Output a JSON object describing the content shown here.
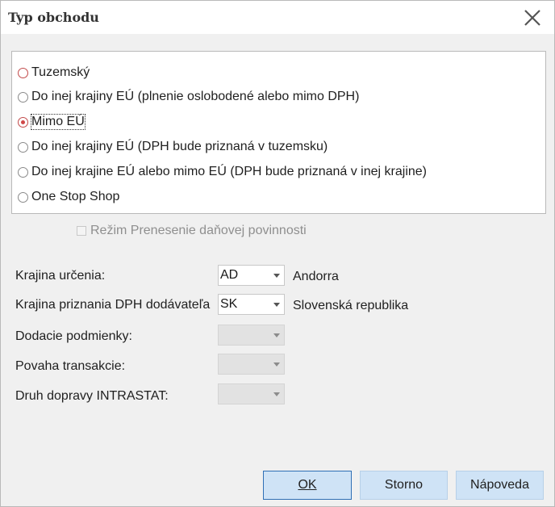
{
  "window": {
    "title": "Typ obchodu",
    "close_icon": "close-icon"
  },
  "trade_type": {
    "options": [
      {
        "label": "Tuzemský",
        "checked": false
      },
      {
        "label": "Do inej krajiny EÚ (plnenie oslobodené alebo mimo DPH)",
        "checked": false
      },
      {
        "label": "Mimo EÚ",
        "checked": true
      },
      {
        "label": "Do inej krajiny EÚ (DPH bude priznaná v tuzemsku)",
        "checked": false
      },
      {
        "label": "Do inej krajine EÚ alebo mimo EÚ (DPH bude priznaná v inej krajine)",
        "checked": false
      },
      {
        "label": "One Stop Shop",
        "checked": false
      }
    ]
  },
  "reverse_charge": {
    "label": "Režim Prenesenie daňovej povinnosti",
    "checked": false,
    "enabled": false
  },
  "fields": {
    "destination_country": {
      "label": "Krajina určenia:",
      "value": "AD",
      "description": "Andorra"
    },
    "supplier_vat_country": {
      "label": "Krajina priznania DPH dodávateľa",
      "value": "SK",
      "description": "Slovenská republika"
    },
    "delivery_terms": {
      "label": "Dodacie podmienky:",
      "value": ""
    },
    "transaction_nature": {
      "label": "Povaha transakcie:",
      "value": ""
    },
    "transport_mode": {
      "label": "Druh dopravy INTRASTAT:",
      "value": ""
    }
  },
  "buttons": {
    "ok": "OK",
    "cancel": "Storno",
    "help": "Nápoveda"
  },
  "colors": {
    "button_bg": "#cfe3f6",
    "default_border": "#2f6fb5",
    "radio_accent": "#d04848"
  }
}
